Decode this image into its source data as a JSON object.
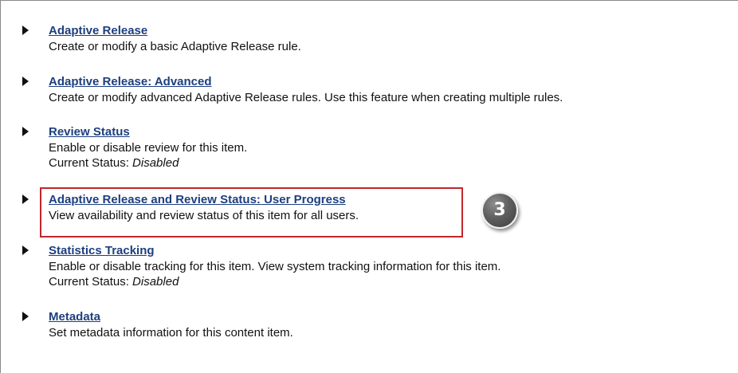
{
  "items": [
    {
      "title": "Adaptive Release",
      "description": "Create or modify a basic Adaptive Release rule."
    },
    {
      "title": "Adaptive Release: Advanced",
      "description": "Create or modify advanced Adaptive Release rules. Use this feature when creating multiple rules."
    },
    {
      "title": "Review Status",
      "description": "Enable or disable review for this item.",
      "status_label": "Current Status: ",
      "status_value": "Disabled"
    },
    {
      "title": "Adaptive Release and Review Status: User Progress",
      "description": "View availability and review status of this item for all users."
    },
    {
      "title": "Statistics Tracking",
      "description": "Enable or disable tracking for this item. View system tracking information for this item.",
      "status_label": "Current Status: ",
      "status_value": "Disabled"
    },
    {
      "title": "Metadata",
      "description": "Set metadata information for this content item."
    }
  ],
  "callout": {
    "number": "3",
    "highlight_color": "#c0272d"
  },
  "colors": {
    "link": "#1d3f7f",
    "text": "#111111"
  },
  "icons": {
    "bullet": "triangle-right-icon"
  }
}
